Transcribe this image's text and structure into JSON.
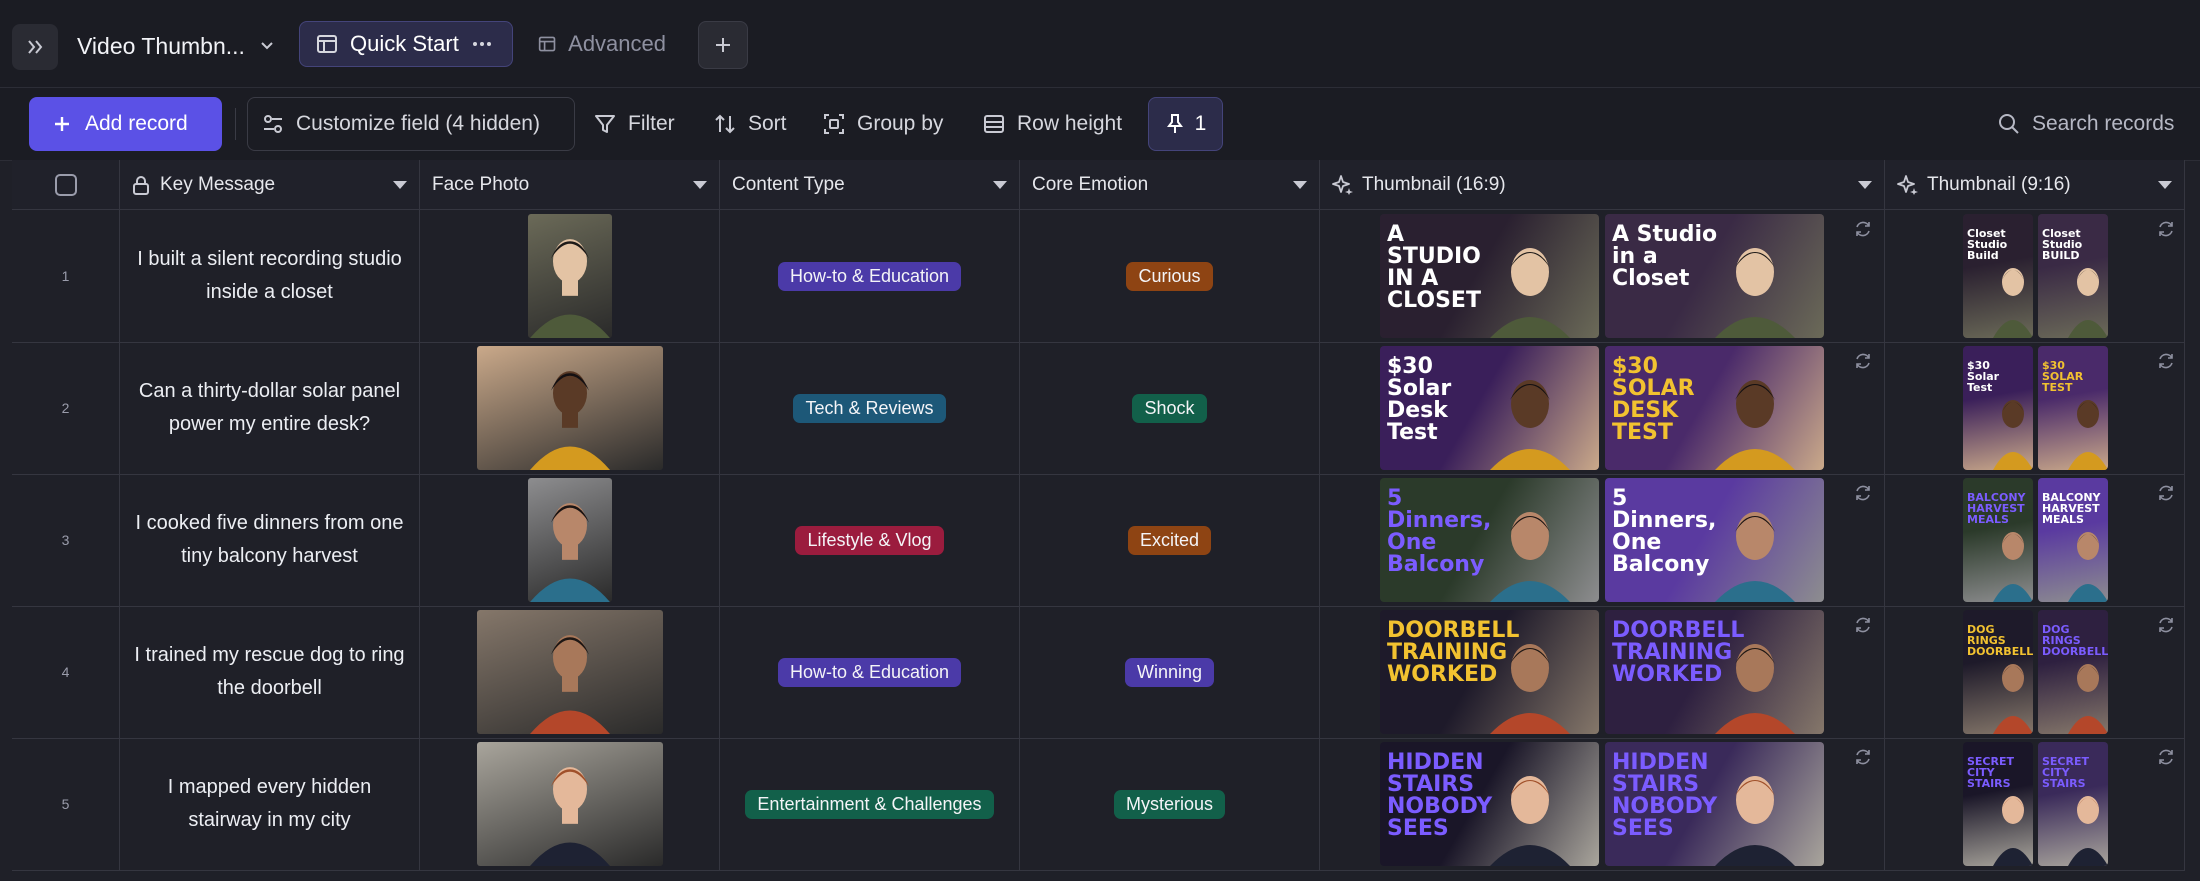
{
  "base": {
    "title": "Video Thumbn..."
  },
  "tabs": [
    {
      "label": "Quick Start"
    },
    {
      "label": "Advanced"
    }
  ],
  "toolbar": {
    "add_record": "Add record",
    "customize_field": "Customize field (4 hidden)",
    "filter": "Filter",
    "sort": "Sort",
    "group_by": "Group by",
    "row_height": "Row height",
    "pinned_count": "1",
    "search_placeholder": "Search records"
  },
  "columns": [
    {
      "label": "Key Message"
    },
    {
      "label": "Face Photo"
    },
    {
      "label": "Content Type"
    },
    {
      "label": "Core Emotion"
    },
    {
      "label": "Thumbnail (16:9)"
    },
    {
      "label": "Thumbnail (9:16)"
    }
  ],
  "colors": {
    "accent": "#5b51e6",
    "how_to_education": "#4b3aa8",
    "tech_reviews": "#1d5878",
    "lifestyle_vlog": "#9b1c3e",
    "entertainment_challenges": "#12604a",
    "curious": "#8e4413",
    "shock": "#12604a",
    "excited": "#8e4413",
    "winning": "#4b3aa8",
    "mysterious": "#12604a"
  },
  "rows": [
    {
      "num": "1",
      "key_message": "I built a silent recording studio inside a closet",
      "content_type": "How-to & Education",
      "core_emotion": "Curious",
      "thumb169": [
        {
          "text": "A STUDIO IN A CLOSET"
        },
        {
          "text": "A Studio in a Closet"
        }
      ],
      "thumb916": [
        {
          "text": "Closet Studio Build"
        },
        {
          "text": "Closet Studio BUILD"
        }
      ]
    },
    {
      "num": "2",
      "key_message": "Can a thirty-dollar solar panel power my entire desk?",
      "content_type": "Tech & Reviews",
      "core_emotion": "Shock",
      "thumb169": [
        {
          "text": "$30 Solar Desk Test"
        },
        {
          "text": "$30 SOLAR DESK TEST"
        }
      ],
      "thumb916": [
        {
          "text": "$30 Solar Test"
        },
        {
          "text": "$30 SOLAR TEST"
        }
      ]
    },
    {
      "num": "3",
      "key_message": "I cooked five dinners from one tiny balcony harvest",
      "content_type": "Lifestyle & Vlog",
      "core_emotion": "Excited",
      "thumb169": [
        {
          "text": "5 Dinners, One Balcony"
        },
        {
          "text": "5 Dinners, One Balcony"
        }
      ],
      "thumb916": [
        {
          "text": "BALCONY HARVEST MEALS"
        },
        {
          "text": "BALCONY HARVEST MEALS"
        }
      ]
    },
    {
      "num": "4",
      "key_message": "I trained my rescue dog to ring the doorbell",
      "content_type": "How-to & Education",
      "core_emotion": "Winning",
      "thumb169": [
        {
          "text": "DOORBELL TRAINING WORKED"
        },
        {
          "text": "DOORBELL TRAINING WORKED"
        }
      ],
      "thumb916": [
        {
          "text": "DOG RINGS DOORBELL"
        },
        {
          "text": "DOG RINGS DOORBELL"
        }
      ]
    },
    {
      "num": "5",
      "key_message": "I mapped every hidden stairway in my city",
      "content_type": "Entertainment & Challenges",
      "core_emotion": "Mysterious",
      "thumb169": [
        {
          "text": "HIDDEN STAIRS NOBODY SEES"
        },
        {
          "text": "HIDDEN STAIRS NOBODY SEES"
        }
      ],
      "thumb916": [
        {
          "text": "SECRET CITY STAIRS"
        },
        {
          "text": "SECRET CITY STAIRS"
        }
      ]
    }
  ]
}
